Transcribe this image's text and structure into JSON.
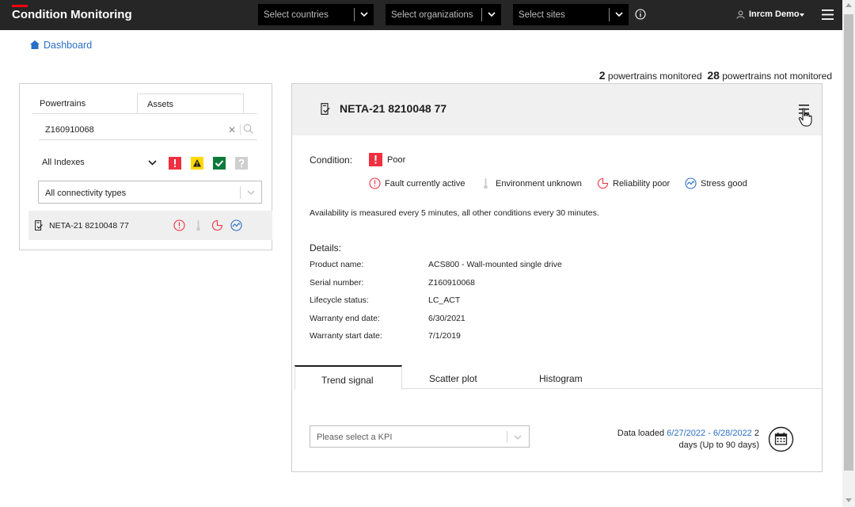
{
  "app": {
    "title": "Condition Monitoring",
    "accent": "#ff000f"
  },
  "topbar": {
    "countries_placeholder": "Select countries",
    "organizations_placeholder": "Select organizations",
    "sites_placeholder": "Select sites",
    "user_name": "Inrcm Demo"
  },
  "breadcrumb": {
    "label": "Dashboard"
  },
  "stats": {
    "monitored_count": "2",
    "monitored_label": "powertrains monitored",
    "not_monitored_count": "28",
    "not_monitored_label": "powertrains not monitored"
  },
  "left": {
    "tabs": [
      "Powertrains",
      "Assets"
    ],
    "search_value": "Z160910068",
    "index_filter": "All Indexes",
    "connectivity": "All connectivity types",
    "asset_name": "NETA-21 8210048 77"
  },
  "main": {
    "title": "NETA-21 8210048 77",
    "condition_label": "Condition:",
    "condition_value": "Poor",
    "indicators": [
      "Fault currently active",
      "Environment unknown",
      "Reliability poor",
      "Stress good"
    ],
    "availability_note": "Availability is measured every 5 minutes, all other conditions every 30 minutes.",
    "details_title": "Details:",
    "details": [
      {
        "key": "Product name:",
        "value": "ACS800 - Wall-mounted single drive"
      },
      {
        "key": "Serial number:",
        "value": "Z160910068"
      },
      {
        "key": "Lifecycle status:",
        "value": "LC_ACT"
      },
      {
        "key": "Warranty end date:",
        "value": "6/30/2021"
      },
      {
        "key": "Warranty start date:",
        "value": "7/1/2019"
      }
    ],
    "tabs": [
      "Trend signal",
      "Scatter plot",
      "Histogram"
    ],
    "kpi_placeholder": "Please select a KPI",
    "data_loaded_prefix": "Data loaded",
    "data_loaded_range": "6/27/2022 - 6/28/2022",
    "data_loaded_count": "2",
    "data_loaded_suffix": "days (Up to 90 days)"
  }
}
